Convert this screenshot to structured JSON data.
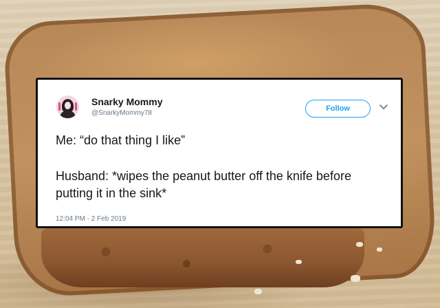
{
  "tweet": {
    "display_name": "Snarky Mommy",
    "handle": "@SnarkyMommy78",
    "follow_label": "Follow",
    "text_line_1": "Me: “do that thing I like”",
    "text_line_2": "Husband: *wipes the peanut butter off the knife before putting it in the sink*",
    "timestamp": "12:04 PM - 2 Feb 2019"
  },
  "colors": {
    "accent": "#1da1f2",
    "text": "#14171a",
    "muted": "#657786",
    "card_border": "#111111"
  },
  "icons": {
    "avatar": "avatar-icon",
    "menu": "chevron-down-icon"
  }
}
